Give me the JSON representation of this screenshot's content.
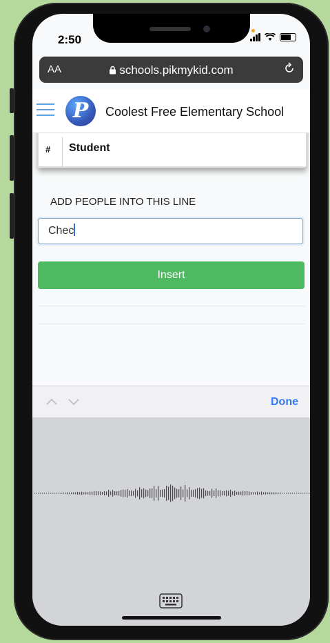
{
  "status": {
    "time": "2:50"
  },
  "browser": {
    "text_size_label": "AA",
    "address": "schools.pikmykid.com"
  },
  "app": {
    "logo_letter": "P",
    "school_name": "Coolest Free Elementary School"
  },
  "table": {
    "col_hash": "#",
    "col_student": "Student"
  },
  "form": {
    "section_label": "ADD PEOPLE INTO THIS LINE",
    "input_value": "Chec",
    "insert_label": "Insert"
  },
  "keyboard": {
    "done_label": "Done"
  },
  "colors": {
    "accent_green": "#4eb960",
    "link_blue": "#3479f6",
    "phone_bg": "#b5d99d"
  }
}
